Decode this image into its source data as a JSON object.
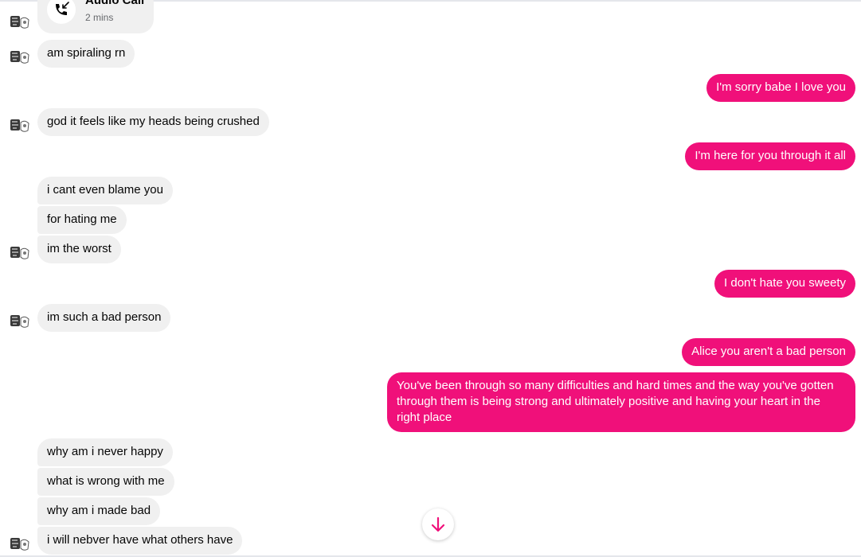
{
  "colors": {
    "outgoing_bubble": "#f0107a",
    "incoming_bubble": "#f0f0f0",
    "background": "#ffffff"
  },
  "call": {
    "title": "Audio Call",
    "duration": "2 mins",
    "icon": "phone-incoming-icon"
  },
  "messages": [
    {
      "side": "in",
      "text": "am spiraling rn"
    },
    {
      "side": "out",
      "text": "I'm sorry babe I love you"
    },
    {
      "side": "in",
      "text": "god it feels like my heads being crushed"
    },
    {
      "side": "out",
      "text": "I'm here for you through it all"
    },
    {
      "side": "in",
      "text": "i cant even blame you"
    },
    {
      "side": "in",
      "text": "for hating me"
    },
    {
      "side": "in",
      "text": "im the worst"
    },
    {
      "side": "out",
      "text": "I don't hate you sweety"
    },
    {
      "side": "in",
      "text": "im such a bad person"
    },
    {
      "side": "out",
      "text": "Alice you aren't a bad person"
    },
    {
      "side": "out",
      "text": "You've been through so many difficulties and hard times and the way you've gotten through them is being strong and ultimately positive and having your heart in the right place"
    },
    {
      "side": "in",
      "text": "why am i never happy"
    },
    {
      "side": "in",
      "text": "what is wrong with me"
    },
    {
      "side": "in",
      "text": "why am i made bad"
    },
    {
      "side": "in",
      "text": "i will nebver have what others have"
    }
  ],
  "scroll_button_icon": "arrow-down-icon"
}
